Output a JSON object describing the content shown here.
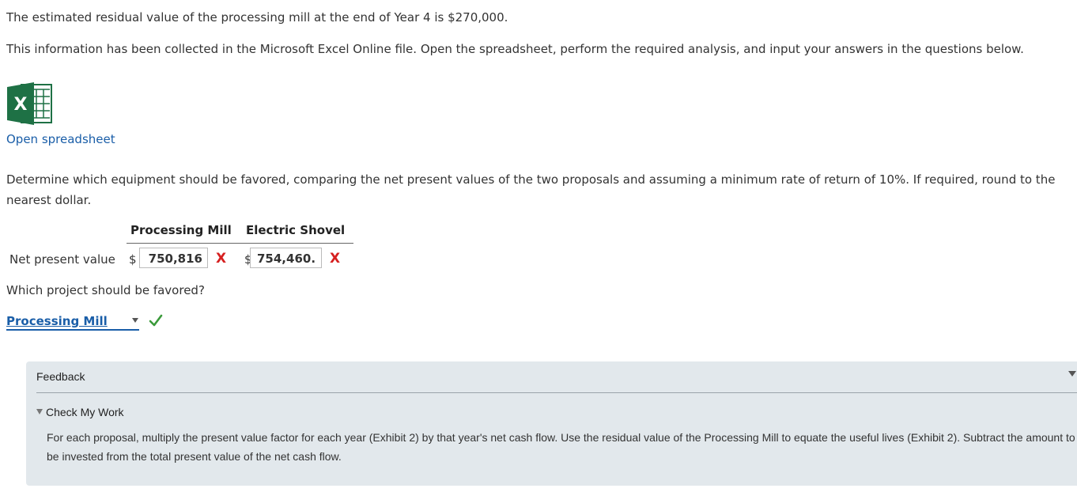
{
  "intro": {
    "residual_text": "The estimated residual value of the processing mill at the end of Year 4 is $270,000.",
    "excel_info_text": "This information has been collected in the Microsoft Excel Online file. Open the spreadsheet, perform the required analysis, and input your answers in the questions below."
  },
  "spreadsheet": {
    "icon": "excel-icon",
    "icon_letter": "X",
    "brand_color": "#1e7145",
    "link_label": "Open spreadsheet"
  },
  "question": {
    "instructions": "Determine which equipment should be favored, comparing the net present values of the two proposals and assuming a minimum rate of return of 10%. If required, round to the nearest dollar.",
    "columns": [
      "Processing Mill",
      "Electric Shovel"
    ],
    "row_label": "Net present value",
    "currency_symbol": "$",
    "answers": [
      {
        "value": "750,816",
        "status": "incorrect",
        "mark": "X"
      },
      {
        "value": "754,460.",
        "status": "incorrect",
        "mark": "X"
      }
    ],
    "favored_question": "Which project should be favored?",
    "favored_selection": "Processing Mill",
    "favored_status": "correct"
  },
  "feedback": {
    "title": "Feedback",
    "check_my_work_label": "Check My Work",
    "text": "For each proposal, multiply the present value factor for each year (Exhibit 2) by that year's net cash flow. Use the residual value of the Processing Mill to equate the useful lives (Exhibit 2). Subtract the amount to be invested from the total present value of the net cash flow."
  },
  "colors": {
    "link": "#1a5ea8",
    "incorrect": "#d62020",
    "correct": "#3a9a3a",
    "feedback_bg": "#e2e8ec"
  }
}
